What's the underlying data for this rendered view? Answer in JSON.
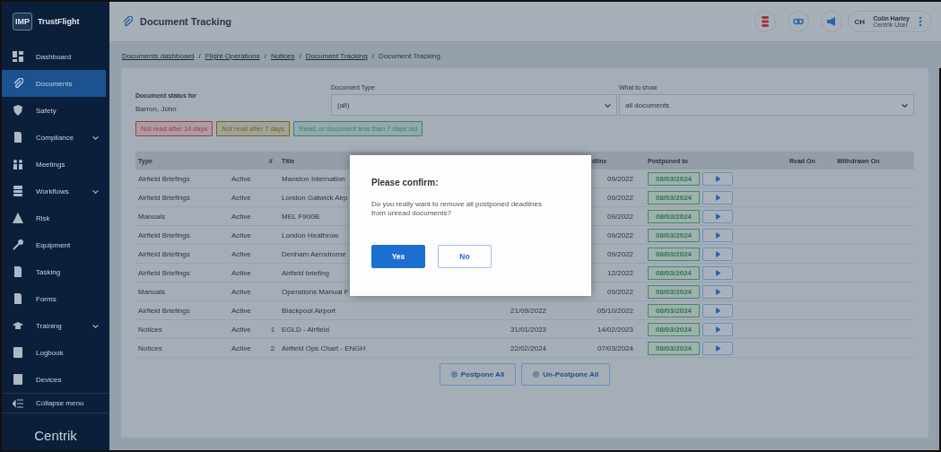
{
  "sidebar": {
    "brand_badge": "IMP",
    "brand": "TrustFlight",
    "items": [
      {
        "label": "Dashboard",
        "selected": false,
        "expandable": false
      },
      {
        "label": "Documents",
        "selected": true,
        "expandable": false
      },
      {
        "label": "Safety",
        "selected": false,
        "expandable": false
      },
      {
        "label": "Compliance",
        "selected": false,
        "expandable": true
      },
      {
        "label": "Meetings",
        "selected": false,
        "expandable": false
      },
      {
        "label": "Workflows",
        "selected": false,
        "expandable": true
      },
      {
        "label": "Risk",
        "selected": false,
        "expandable": false
      },
      {
        "label": "Equipment",
        "selected": false,
        "expandable": false
      },
      {
        "label": "Tasking",
        "selected": false,
        "expandable": false
      },
      {
        "label": "Forms",
        "selected": false,
        "expandable": false
      },
      {
        "label": "Training",
        "selected": false,
        "expandable": true
      },
      {
        "label": "Logbook",
        "selected": false,
        "expandable": false
      },
      {
        "label": "Devices",
        "selected": false,
        "expandable": false
      }
    ],
    "collapse": "Collapse menu",
    "footer_logo": "Centrik"
  },
  "header": {
    "title": "Document Tracking",
    "user": {
      "initials": "CH",
      "name": "Colin Harley",
      "role": "Centrik User"
    }
  },
  "breadcrumbs": [
    {
      "label": "Documents dashboard",
      "link": true
    },
    {
      "separator": "/",
      "label": "Flight Operations",
      "link": true
    },
    {
      "separator": "/",
      "label": "Notices",
      "link": true
    },
    {
      "separator": "/",
      "label": "Document Tracking",
      "link": true
    },
    {
      "separator": "/",
      "label": "Document Tracking",
      "link": false
    }
  ],
  "filters": {
    "status_for": {
      "label": "Document status for",
      "value": "Barron, John"
    },
    "document_type": {
      "label": "Document Type",
      "value": "(all)"
    },
    "what_to_show": {
      "label": "What to show",
      "value": "all documents"
    }
  },
  "legend": [
    {
      "label": "Not read after 14 days",
      "color": "#b3333a"
    },
    {
      "label": "Not read after 7 days",
      "color": "#7a6508"
    },
    {
      "label": "Read, or document less than 7 days old",
      "color": "#2a8a68"
    }
  ],
  "table": {
    "columns": [
      {
        "label": "Type"
      },
      {
        "label": "#"
      },
      {
        "label": "Title"
      },
      {
        "label": "dline"
      },
      {
        "label": "Postponed to"
      },
      {
        "label": "Read On"
      },
      {
        "label": "Withdrawn On"
      }
    ],
    "rows": [
      {
        "type": "Airfield Briefings",
        "status": "Active",
        "title": "Manston Internation",
        "deadline": "09/2022",
        "postponed_to": "08/03/2024"
      },
      {
        "type": "Airfield Briefings",
        "status": "Active",
        "title": "London Gatwick Airp",
        "deadline": "09/2022",
        "postponed_to": "08/03/2024"
      },
      {
        "type": "Manuals",
        "status": "Active",
        "title": "MEL F900B",
        "deadline": "09/2022",
        "postponed_to": "08/03/2024"
      },
      {
        "type": "Airfield Briefings",
        "status": "Active",
        "title": "London Heathrow",
        "deadline": "09/2022",
        "postponed_to": "08/03/2024"
      },
      {
        "type": "Airfield Briefings",
        "status": "Active",
        "title": "Denham Aerodrome",
        "deadline": "09/2022",
        "postponed_to": "08/03/2024"
      },
      {
        "type": "Airfield Briefings",
        "status": "Active",
        "title": "Airfield briefing",
        "deadline": "12/2022",
        "postponed_to": "08/03/2024"
      },
      {
        "type": "Manuals",
        "status": "Active",
        "title": "Operations Manual F",
        "deadline": "09/2022",
        "postponed_to": "08/03/2024"
      },
      {
        "type": "Airfield Briefings",
        "status": "Active",
        "title": "Blackpool Airport",
        "issued": "21/09/2022",
        "deadline": "05/10/2022",
        "postponed_to": "08/03/2024"
      },
      {
        "type": "Notices",
        "status": "Active",
        "number": "1",
        "title": "EGLD - Airfield",
        "issued": "31/01/2023",
        "deadline": "14/02/2023",
        "postponed_to": "08/03/2024"
      },
      {
        "type": "Notices",
        "status": "Active",
        "number": "2",
        "title": "Airfield Ops Chart - ENGH",
        "issued": "22/02/2024",
        "deadline": "07/03/2024",
        "postponed_to": "08/03/2024"
      }
    ]
  },
  "actions": [
    {
      "label": "Postpone All"
    },
    {
      "label": "Un-Postpone All"
    }
  ],
  "dialog": {
    "title": "Please confirm:",
    "message": "Do you really want to remove all postponed deadlines from unread documents?",
    "buttons": [
      {
        "label": "Yes",
        "kind": "primary"
      },
      {
        "label": "No",
        "kind": "secondary"
      }
    ]
  }
}
